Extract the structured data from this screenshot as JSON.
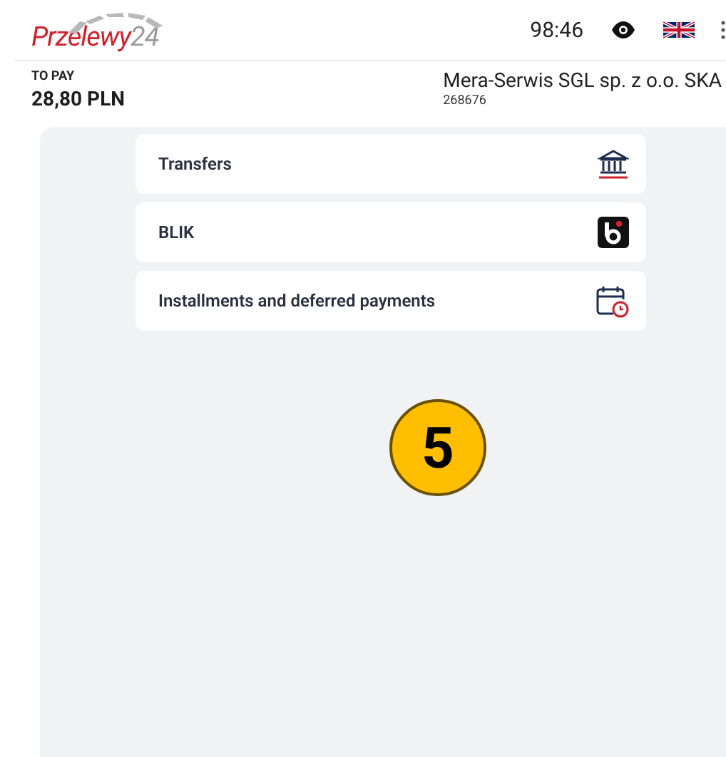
{
  "header": {
    "logo": {
      "name": "Przelewy",
      "suffix": "24"
    },
    "timer": "98:46"
  },
  "payment": {
    "label": "TO PAY",
    "amount": "28,80 PLN",
    "merchant": "Mera-Serwis SGL sp. z o.o. SKA",
    "merchant_id": "268676"
  },
  "methods": [
    {
      "label": "Transfers",
      "kind": "bank"
    },
    {
      "label": "BLIK",
      "kind": "blik"
    },
    {
      "label": "Installments and deferred payments",
      "kind": "calendar"
    }
  ],
  "step_marker": "5"
}
